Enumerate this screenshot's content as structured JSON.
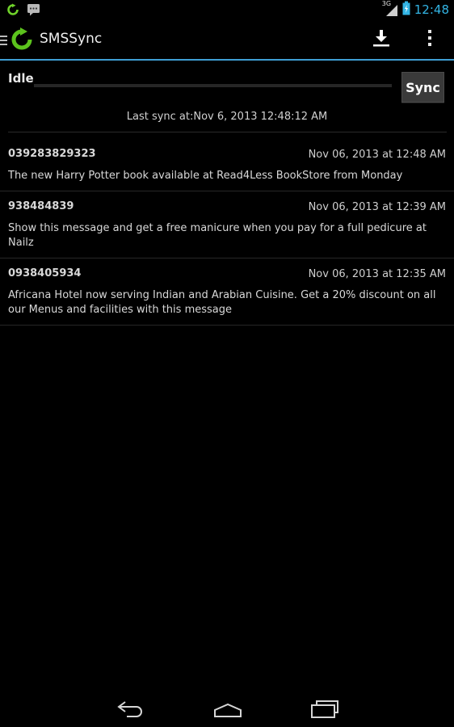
{
  "status_bar": {
    "time": "12:48",
    "network": "3G",
    "left_icons": [
      "sync-notification-icon",
      "message-notification-icon"
    ],
    "right_icons": [
      "signal-icon",
      "battery-icon"
    ]
  },
  "action_bar": {
    "title": "SMSSync",
    "icons": [
      "drawer-icon",
      "app-logo",
      "download-icon",
      "overflow-menu-icon"
    ],
    "accent_color": "#33b5e5"
  },
  "sync_panel": {
    "status": "Idle",
    "progress": 0,
    "sync_button_label": "Sync",
    "last_sync": "Last sync at:Nov 6, 2013 12:48:12 AM"
  },
  "messages": [
    {
      "sender": "039283829323",
      "date": "Nov 06, 2013 at 12:48 AM",
      "body": "The new Harry Potter book available at Read4Less BookStore from Monday"
    },
    {
      "sender": "938484839",
      "date": "Nov 06, 2013 at 12:39 AM",
      "body": "Show this message and get a free manicure when you pay for a full pedicure at Nailz"
    },
    {
      "sender": "0938405934",
      "date": "Nov 06, 2013 at 12:35 AM",
      "body": "Africana Hotel now serving Indian and Arabian Cuisine. Get a 20% discount on all our Menus and facilities with this message"
    }
  ],
  "nav_bar": {
    "icons": [
      "back-icon",
      "home-icon",
      "recent-apps-icon"
    ]
  }
}
